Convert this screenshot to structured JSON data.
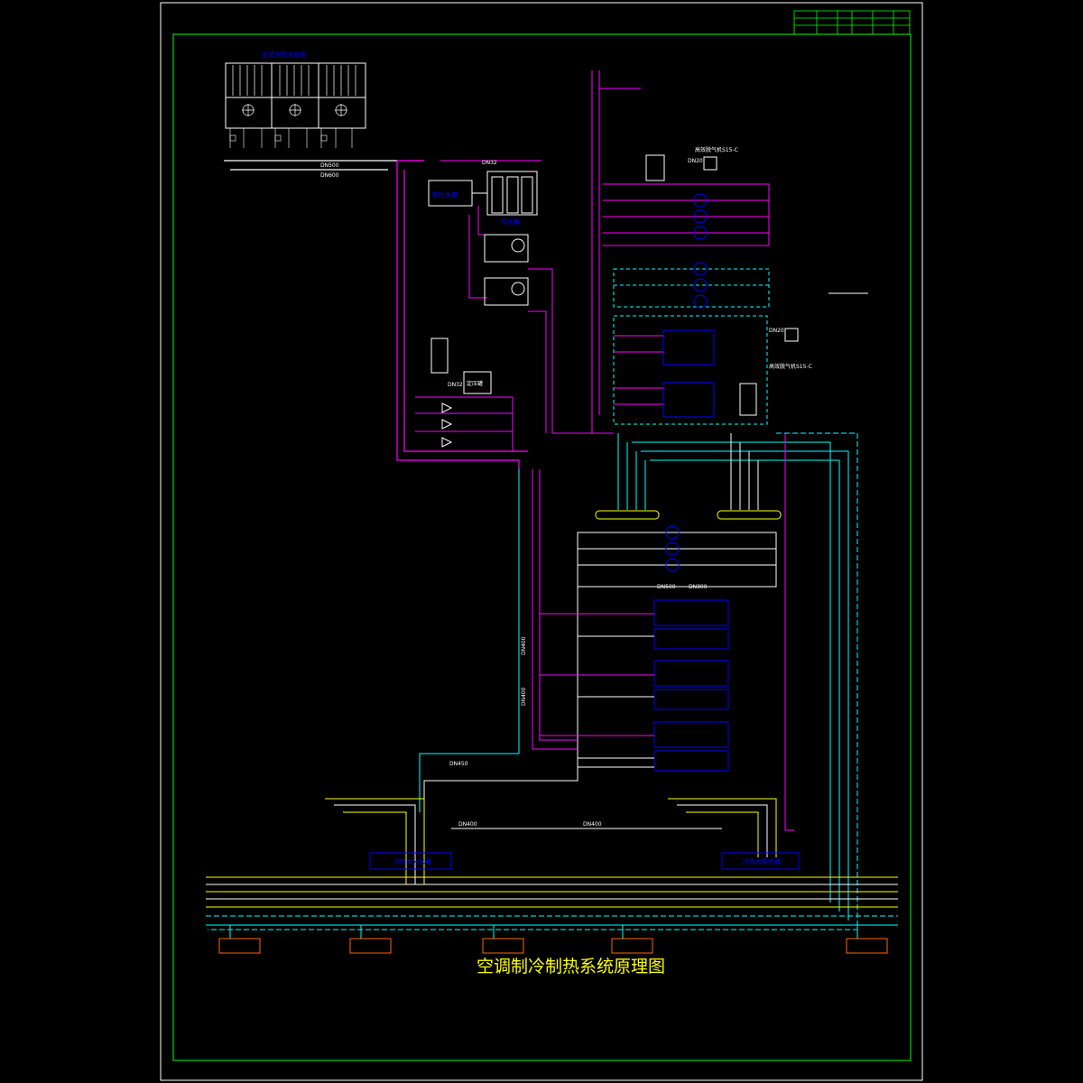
{
  "drawing": {
    "title": "空调制冷制热系统原理图",
    "cooling_tower_label": "逆流方圆冷却塔",
    "pipe_sizes": {
      "dn500": "DN500",
      "dn600": "DN600",
      "dn300": "DN300",
      "dn150": "DN150",
      "dn32": "DN32",
      "dn25": "DN25",
      "dn20": "DN20",
      "dn400": "DN400",
      "dn450": "DN450",
      "dn250": "DN250"
    },
    "equipment": {
      "makeup_tank": "软化水箱",
      "softener": "软水器",
      "expansion_tank": "定压罐",
      "exhaust_valve_1": "高效脱气机S15-C",
      "exhaust_valve_2": "高效脱气机S15-C",
      "supply_header": "冷热水分水器",
      "return_header": "冷热水集水器",
      "building_supply": "接市政自来水"
    }
  },
  "colors": {
    "frame": "#00ff00",
    "supply": "#ff00ff",
    "return": "#00ffff",
    "makeup": "#ffff00",
    "equipment": "#ffffff",
    "header": "#0000ff",
    "title": "#ffff00",
    "terminal": "#ff6600"
  }
}
